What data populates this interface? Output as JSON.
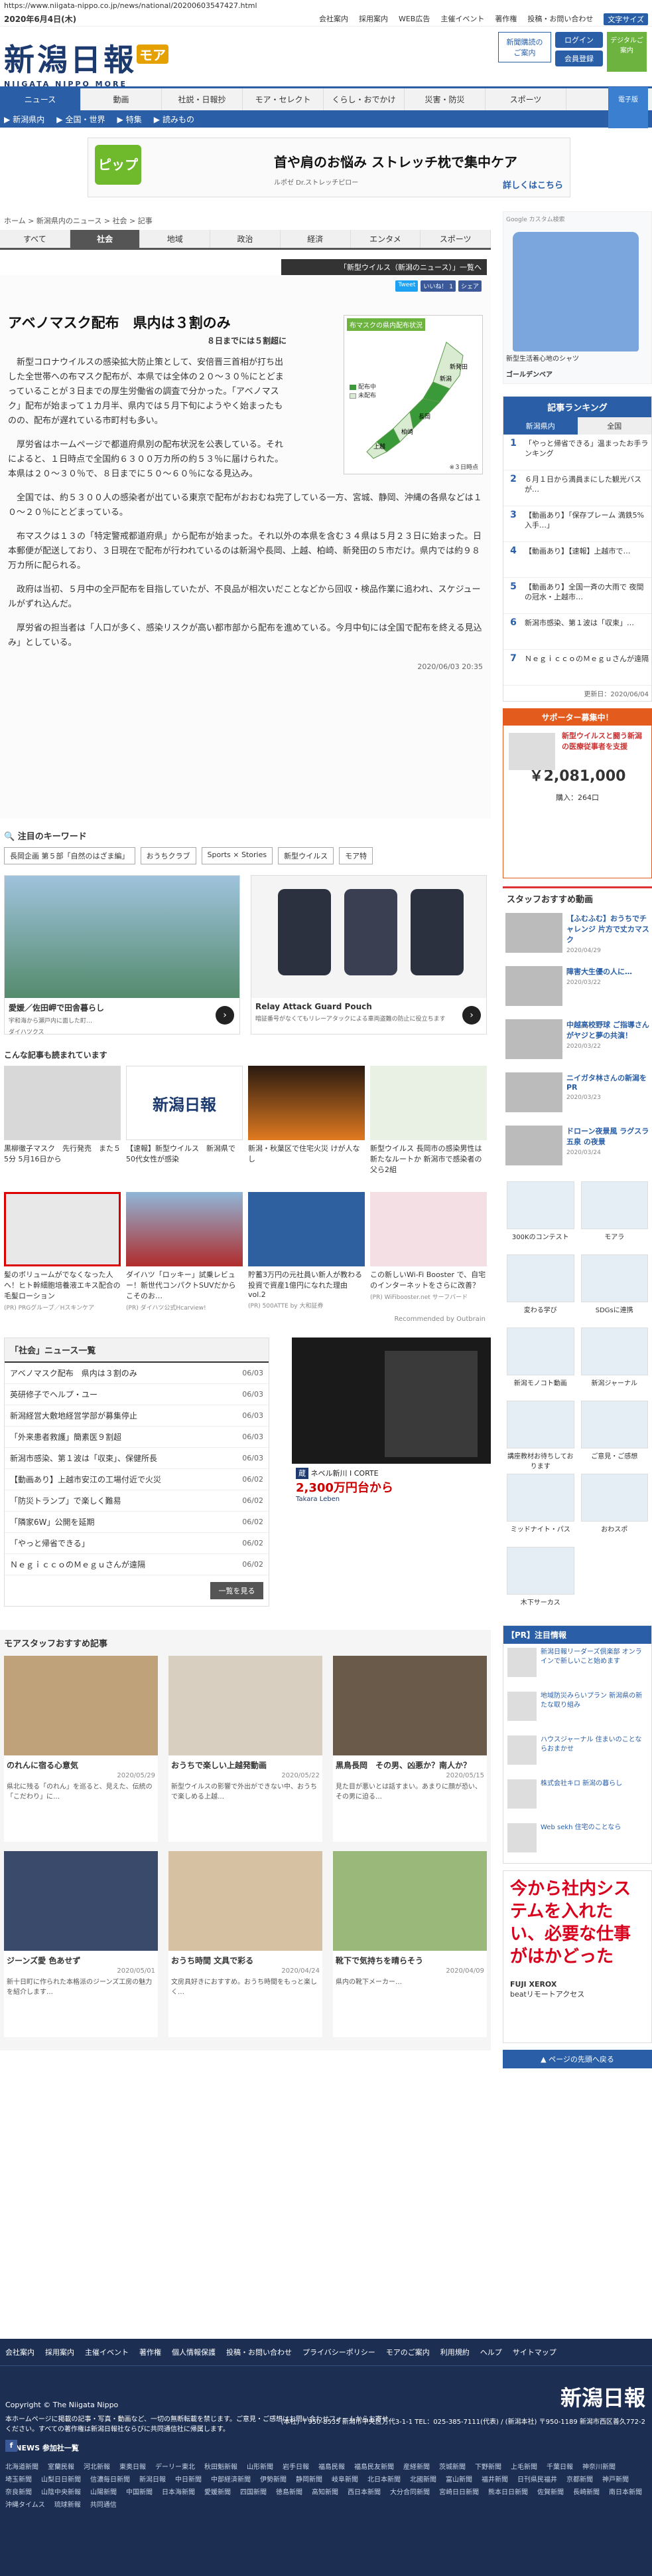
{
  "url": "https://www.niigata-nippo.co.jp/news/national/20200603547427.html",
  "topbar": {
    "date": "2020年6月4日(木)",
    "links": [
      "会社案内",
      "採用案内",
      "WEB広告",
      "主催イベント",
      "著作権",
      "投稿・お問い合わせ"
    ],
    "font_size": "文字サイズ"
  },
  "logo": {
    "main": "新潟日報",
    "roman": "NIIGATA NIPPO MORE",
    "badge": "モア"
  },
  "masthead": {
    "member_box": "新聞購読のご案内",
    "login": "ログイン",
    "register": "会員登録",
    "digital": "デジタルご案内"
  },
  "nav": [
    "ニュース",
    "動画",
    "社説・日報抄",
    "モア・セレクト",
    "くらし・おでかけ",
    "災害・防災",
    "スポーツ"
  ],
  "subnav": [
    "新潟県内",
    "全国・世界",
    "特集",
    "読みもの"
  ],
  "app_icon": "電子版",
  "banner": {
    "brand": "ピップ",
    "headline": "首や肩のお悩み ストレッチ枕で集中ケア",
    "sub": "ルポゼ Dr.ストレッチピロー",
    "more": "詳しくはこちら"
  },
  "breadcrumb": [
    "ホーム",
    "新潟県内のニュース",
    "社会",
    "記事"
  ],
  "tabs": [
    "すべて",
    "社会",
    "地域",
    "政治",
    "経済",
    "エンタメ",
    "スポーツ"
  ],
  "tag_link": "「新型ウイルス（新潟のニュース）」一覧へ",
  "share": {
    "tweet": "Tweet",
    "like": "いいね！ 1",
    "share": "シェア"
  },
  "article": {
    "title": "アベノマスク配布　県内は３割のみ",
    "subtitle": "８日までには５割超に",
    "paragraphs": [
      "新型コロナウイルスの感染拡大防止策として、安倍晋三首相が打ち出した全世帯への布マスク配布が、本県では全体の２０～３０％にとどまっていることが３日までの厚生労働省の調査で分かった。「アベノマスク」配布が始まって１カ月半、県内では５月下旬にようやく始まったものの、配布が遅れている市町村も多い。",
      "厚労省はホームページで都道府県別の配布状況を公表している。それによると、１日時点で全国約６３００万カ所の約５３％に届けられた。本県は２０～３０％で、８日までに５０～６０％になる見込み。",
      "全国では、約５３００人の感染者が出ている東京で配布がおおむね完了している一方、宮城、静岡、沖縄の各県などは１０～２０％にとどまっている。",
      "布マスクは１３の「特定警戒都道府県」から配布が始まった。それ以外の本県を含む３４県は５月２３日に始まった。日本郵便が配送しており、３日現在で配布が行われているのは新潟や長岡、上越、柏崎、新発田の５市だけ。県内では約９８万カ所に配られる。",
      "政府は当初、５月中の全戸配布を目指していたが、不良品が相次いだことなどから回収・検品作業に追われ、スケジュールがずれ込んだ。",
      "厚労省の担当者は「人口が多く、感染リスクが高い都市部から配布を進めている。今月中旬には全国で配布を終える見込み」としている。"
    ],
    "date": "2020/06/03 20:35"
  },
  "map": {
    "title": "布マスクの県内配布状況",
    "legend": [
      "配布中",
      "未配布"
    ],
    "cities": [
      "新潟",
      "新発田",
      "長岡",
      "柏崎",
      "上越"
    ],
    "foot": "※３日時点",
    "colors": {
      "active": "#3a9a3a",
      "none": "#d9ebd0"
    }
  },
  "keywords": {
    "title": "注目のキーワード",
    "items": [
      "長岡企画 第５部「自然のはざま編」",
      "おうちクラブ",
      "Sports × Stories",
      "新型ウイルス",
      "モア特"
    ]
  },
  "promos": [
    {
      "title": "愛媛／佐田岬で田舎暮らし",
      "sub": "宇和海から瀬戸内に面した町…",
      "brand": "ダイハツクス"
    },
    {
      "title": "Relay Attack Guard Pouch",
      "sub": "暗証番号がなくてもリレーアタックによる車両盗難の防止に役立ちます",
      "brand": ""
    }
  ],
  "rec": {
    "title": "こんな記事も読まれています",
    "items": [
      {
        "t": "黒柳徹子マスク　先行発売　また５5分 5月16日から",
        "s": ""
      },
      {
        "t": "【速報】新型ウイルス　新潟県で50代女性が感染",
        "s": ""
      },
      {
        "t": "新潟・秋葉区で住宅火災 けが人なし",
        "s": ""
      },
      {
        "t": "新型ウイルス 長岡市の感染男性は新たなルートか 新潟市で感染者の父ら2組",
        "s": ""
      },
      {
        "t": "髪のボリュームがでなくなった人へ！ヒト幹細胞培養液エキス配合の毛髪ローション",
        "s": "(PR) PRGグループ／Hスキンケア"
      },
      {
        "t": "ダイハツ「ロッキー」試乗レビュー！新世代コンパクトSUVだからこそのお…",
        "s": "(PR) ダイハツ公式Hcarview!"
      },
      {
        "t": "貯蓄3万円の元社員い新人が教わる投資で資産1億円になれた理由 vol.2",
        "s": "(PR) 500ATTE by 大和証券"
      },
      {
        "t": "この新しいWi-Fi Booster で、自宅のインターネットをさらに改善？",
        "s": "(PR) WiFibooster.net サーフバード"
      }
    ],
    "outbrain": "Recommended by Outbrain"
  },
  "news_list": {
    "title": "「社会」ニュース一覧",
    "rows": [
      {
        "t": "アベノマスク配布　県内は３割のみ",
        "d": "06/03"
      },
      {
        "t": "英研修子でヘルプ・ユー",
        "d": "06/03"
      },
      {
        "t": "新潟経営大敷地経営学部が募集停止",
        "d": "06/03"
      },
      {
        "t": "「外来患者救護」簡素医９割超",
        "d": "06/03"
      },
      {
        "t": "新潟市感染、第１波は「収束」、保健所長",
        "d": "06/03"
      },
      {
        "t": "【動画あり】上越市安江の工場付近で火災",
        "d": "06/02"
      },
      {
        "t": "「防災トランプ」で楽しく難易",
        "d": "06/02"
      },
      {
        "t": "「隣家6W」公開を延期",
        "d": "06/02"
      },
      {
        "t": "「やっと帰省できる」",
        "d": "06/02"
      },
      {
        "t": "ＮｅｇｉｃｃｏのＭｅｇｕさんが遠隔",
        "d": "06/02"
      }
    ],
    "more": "一覧を見る"
  },
  "ad_300": {
    "brand": "Takara Leben",
    "name": "ネベル新川 I CORTE",
    "price": "2,300万円台から",
    "label": "蔵"
  },
  "moa": {
    "title": "モアスタッフおすすめ記事",
    "items": [
      {
        "t": "のれんに宿る心意気",
        "d": "2020/05/29",
        "desc": "県北に残る「のれん」を巡ると、見えた、伝統の「こだわり」に…"
      },
      {
        "t": "おうちで楽しい上越発動画",
        "d": "2020/05/22",
        "desc": "新型ウイルスの影響で外出ができない中、おうちで楽しめる上越…"
      },
      {
        "t": "黒鳥長岡　その男、凶悪か？南人か？",
        "d": "2020/05/15",
        "desc": "見た目が悪いとは話すまい。あまりに顔が恐い、その男に迫る…"
      },
      {
        "t": "ジーンズ愛 色あせず",
        "d": "2020/05/01",
        "desc": "新十日町に作られた本格派のジーンズ工房の魅力を紹介します…"
      },
      {
        "t": "おうち時間 文具で彩る",
        "d": "2020/04/24",
        "desc": "文房具好きにおすすめ。おうち時間をもっと楽しく…"
      },
      {
        "t": "靴下で気持ちを晴らそう",
        "d": "2020/04/09",
        "desc": "県内の靴下メーカー…"
      }
    ]
  },
  "side_ad": {
    "caption": "新型生活着心地のシャツ",
    "brand": "ゴールデンベア"
  },
  "ranking": {
    "title": "記事ランキング",
    "tabs": [
      "新潟県内",
      "全国"
    ],
    "items": [
      "「やっと帰省できる」温まったお手ランキング",
      "６月１日から満員まにした観光バスが…",
      "【動画あり】「保存プレーム 満鉄5%入手…」",
      "【動画あり】【速報】上越市で…",
      "【動画あり】全国一斉の大雨で 夜間の冠水・上越市…",
      "新潟市感染、第１波は「収束」…",
      "ＮｅｇｉｃｃｏのＭｅｇｕさんが遠隔"
    ],
    "updated": "更新日：2020/06/04"
  },
  "support": {
    "title": "サポーター募集中！",
    "desc": "新型ウイルスと闘う新潟の医療従事者を支援",
    "amount": "￥2,081,000",
    "count": "購入：264口"
  },
  "staff": {
    "title": "スタッフおすすめ動画",
    "items": [
      {
        "t": "【ふむふむ】おうちでチャレンジ 片方で丈カマスク",
        "d": "2020/04/29"
      },
      {
        "t": "障害大生優の人に…",
        "d": "2020/03/22"
      },
      {
        "t": "中越高校野球 ご指導さんがヤジと夢の共演！",
        "d": "2020/03/22"
      },
      {
        "t": "ニイガタ林さんの新潟をPR",
        "d": "2020/03/23"
      },
      {
        "t": "ドローン夜景風 ラグスラ 五泉 の夜景",
        "d": "2020/03/24"
      }
    ]
  },
  "services": [
    "300Kのコンテスト",
    "モアラ",
    "変わる学び",
    "SDGsに連携",
    "新潟モノコト動画",
    "新潟ジャーナル",
    "講座教材お待ちしております",
    "ご意見・ご感想",
    "ミッドナイト・パス",
    "おわスポ",
    "木下サーカス"
  ],
  "pr": {
    "title": "【PR】注目情報",
    "items": [
      "新潟日報リーダーズ倶楽部 オンラインで新しいこと始めます",
      "地域防災みらいプラン 新潟県の新たな取り組み",
      "ハウスジャーナル 住まいのことならおまかせ",
      "株式会社キロ 新潟の暮らし",
      "Web sekh 住宅のことなら"
    ]
  },
  "fuji": {
    "headline": "今から社内システムを入れたい、必要な仕事がはかどった",
    "logo": "FUJI XEROX",
    "sub": "beatリモートアクセス"
  },
  "totop": "ページの先頭へ戻る",
  "footer": {
    "links": [
      "会社案内",
      "採用案内",
      "主催イベント",
      "著作権",
      "個人情報保護",
      "投稿・お問い合わせ",
      "プライバシーポリシー",
      "モアのご案内",
      "利用規約",
      "ヘルプ",
      "サイトマップ"
    ],
    "logo": "新潟日報",
    "copyright": "Copyright © The Niigata Nippo",
    "note": "本ホームページに掲載の記事・写真・動画など、一切の無断転載を禁じます。ご意見・ご感想はお問い合わせフォームからお寄せください。すべての著作権は新潟日報社ならびに共同通信社に帰属します。",
    "address": "(本社) 〒950-8535 新潟市中央区万代3-1-1 TEL：025-385-7111(代表) / (新潟本社) 〒950-1189 新潟市西区善久772-2",
    "p47": "47NEWS 参加社一覧",
    "papers": [
      "北海道新聞",
      "室蘭民報",
      "河北新報",
      "東奥日報",
      "デーリー東北",
      "秋田魁新報",
      "山形新聞",
      "岩手日報",
      "福島民報",
      "福島民友新聞",
      "産経新聞",
      "茨城新聞",
      "下野新聞",
      "上毛新聞",
      "千葉日報",
      "神奈川新聞",
      "埼玉新聞",
      "山梨日日新聞",
      "信濃毎日新聞",
      "新潟日報",
      "中日新聞",
      "中部経済新聞",
      "伊勢新聞",
      "静岡新聞",
      "岐阜新聞",
      "北日本新聞",
      "北國新聞",
      "富山新聞",
      "福井新聞",
      "日刊県民福井",
      "京都新聞",
      "神戸新聞",
      "奈良新聞",
      "山陰中央新報",
      "山陽新聞",
      "中国新聞",
      "日本海新聞",
      "愛媛新聞",
      "四国新聞",
      "徳島新聞",
      "高知新聞",
      "西日本新聞",
      "大分合同新聞",
      "宮崎日日新聞",
      "熊本日日新聞",
      "佐賀新聞",
      "長崎新聞",
      "南日本新聞",
      "沖縄タイムス",
      "琉球新報",
      "共同通信"
    ]
  }
}
